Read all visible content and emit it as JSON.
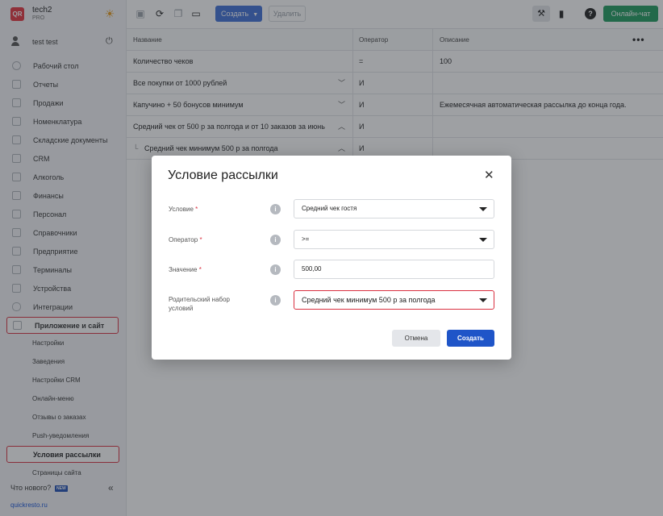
{
  "brand": {
    "name": "tech2",
    "plan": "PRO",
    "logo_text": "QR"
  },
  "user": {
    "name": "test test"
  },
  "sidebar": {
    "items": [
      {
        "label": "Рабочий стол"
      },
      {
        "label": "Отчеты"
      },
      {
        "label": "Продажи"
      },
      {
        "label": "Номенклатура"
      },
      {
        "label": "Складские документы"
      },
      {
        "label": "CRM"
      },
      {
        "label": "Алкоголь"
      },
      {
        "label": "Финансы"
      },
      {
        "label": "Персонал"
      },
      {
        "label": "Справочники"
      },
      {
        "label": "Предприятие"
      },
      {
        "label": "Терминалы"
      },
      {
        "label": "Устройства"
      },
      {
        "label": "Интеграции"
      },
      {
        "label": "Приложение и сайт"
      }
    ],
    "subitems": [
      {
        "label": "Настройки"
      },
      {
        "label": "Заведения"
      },
      {
        "label": "Настройки CRM"
      },
      {
        "label": "Онлайн-меню"
      },
      {
        "label": "Отзывы о заказах"
      },
      {
        "label": "Push-уведомления"
      },
      {
        "label": "Условия рассылки"
      },
      {
        "label": "Страницы сайта"
      }
    ],
    "whats_new": "Что нового?",
    "new_badge": "NEW",
    "site_link": "quickresto.ru"
  },
  "toolbar": {
    "create_label": "Создать",
    "delete_label": "Удалить",
    "chat_label": "Онлайн-чат"
  },
  "table": {
    "headers": {
      "name": "Название",
      "operator": "Оператор",
      "description": "Описание"
    },
    "rows": [
      {
        "name": "Количество чеков",
        "operator": "=",
        "description": "100"
      },
      {
        "name": "Все покупки от 1000 рублей",
        "operator": "И",
        "description": ""
      },
      {
        "name": "Капучино + 50 бонусов минимум",
        "operator": "И",
        "description": "Ежемесячная автоматическая рассылка до конца года."
      },
      {
        "name": "Средний чек от 500 р за полгода и от 10 заказов за июнь",
        "operator": "И",
        "description": ""
      },
      {
        "name": "Средний чек минимум 500 р за полгода",
        "operator": "И",
        "description": ""
      }
    ]
  },
  "modal": {
    "title": "Условие рассылки",
    "fields": {
      "condition": {
        "label": "Условие",
        "value": "Средний чек гостя"
      },
      "operator": {
        "label": "Оператор",
        "value": ">="
      },
      "value": {
        "label": "Значение",
        "value": "500,00"
      },
      "parent": {
        "label_line1": "Родительский набор",
        "label_line2": "условий",
        "value": "Средний чек минимум 500 р за полгода"
      }
    },
    "required_mark": "*",
    "cancel_label": "Отмена",
    "submit_label": "Создать"
  },
  "colors": {
    "accent": "#3f6fd8",
    "primary": "#1f55c8",
    "chat": "#1e9b5e",
    "error": "#d93040"
  }
}
